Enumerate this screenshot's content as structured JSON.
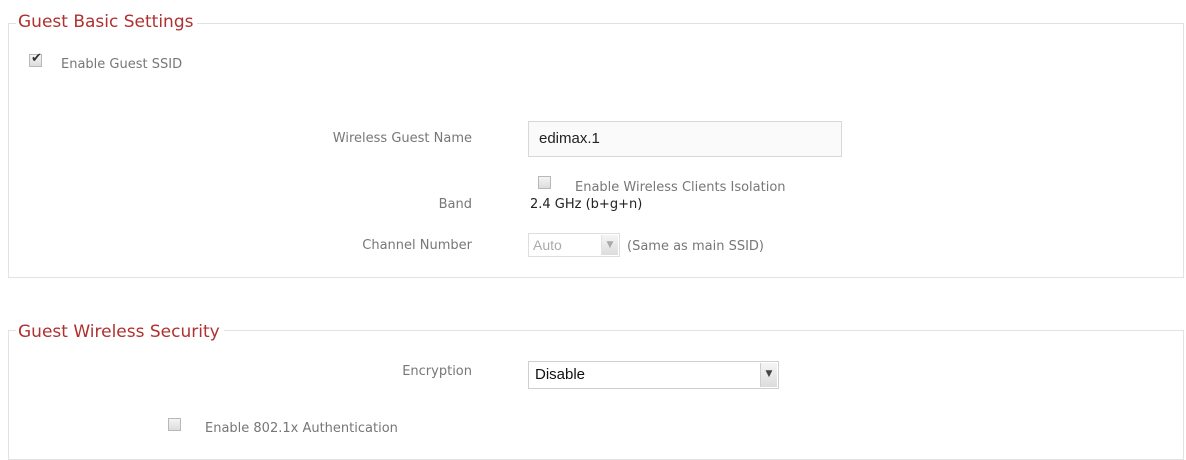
{
  "basic": {
    "legend": "Guest  Basic Settings",
    "enable_guest_ssid": {
      "label": "Enable  Guest  SSID",
      "checked": true
    },
    "guest_name": {
      "label": "Wireless Guest Name",
      "value": "edimax.1"
    },
    "isolation": {
      "label": "Enable Wireless Clients Isolation",
      "checked": false
    },
    "band": {
      "label": "Band",
      "value": "2.4 GHz (b+g+n)"
    },
    "channel": {
      "label": "Channel Number",
      "value": "Auto",
      "note": "(Same as main SSID)"
    }
  },
  "security": {
    "legend": "Guest  Wireless  Security",
    "encryption": {
      "label": "Encryption",
      "value": "Disable"
    },
    "auth_8021x": {
      "label": "Enable 802.1x Authentication",
      "checked": false
    }
  },
  "colors": {
    "legend": "#b03030",
    "border": "#e2e2e2"
  }
}
